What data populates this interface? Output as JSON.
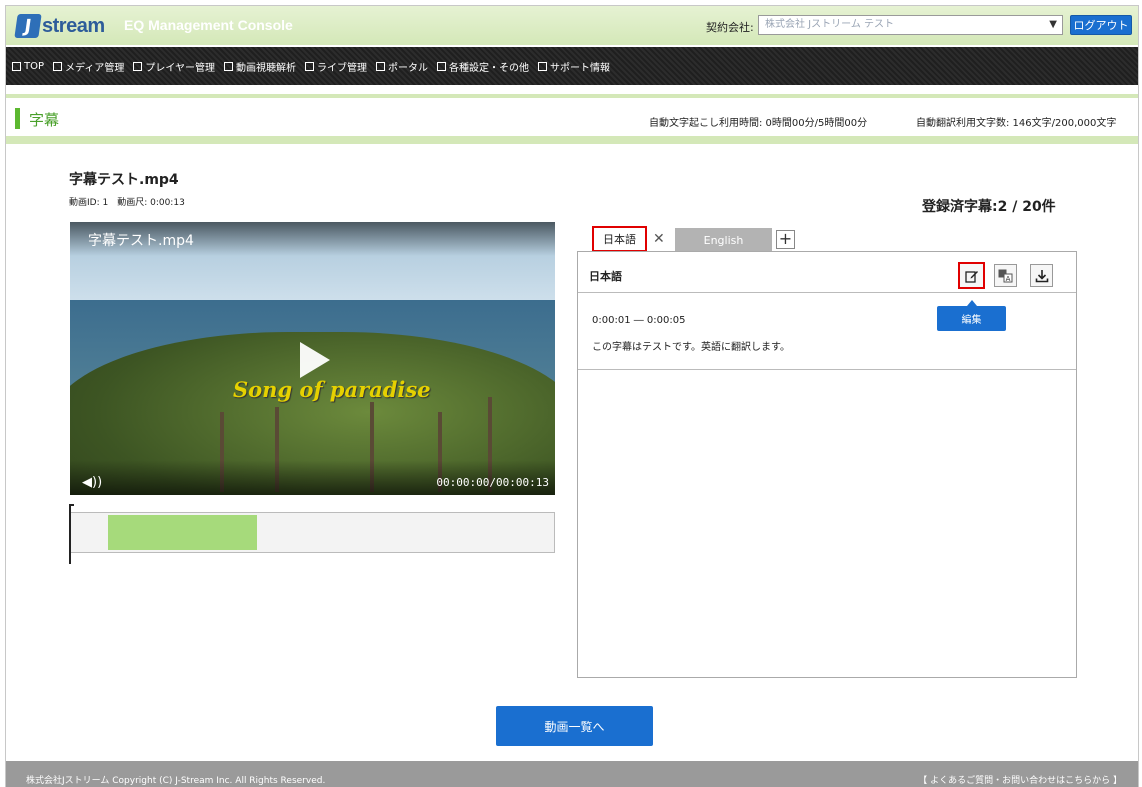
{
  "header": {
    "logo_text": "stream",
    "logo_letter": "J",
    "console_title": "EQ Management Console",
    "contract_label": "契約会社:",
    "contract_value": "株式会社 Jストリーム テスト",
    "logout_label": "ログアウト"
  },
  "nav": {
    "items": [
      "TOP",
      "メディア管理",
      "プレイヤー管理",
      "動画視聴解析",
      "ライブ管理",
      "ポータル",
      "各種設定・その他",
      "サポート情報"
    ]
  },
  "page": {
    "title": "字幕",
    "usage_transcription": "自動文字起こし利用時間: 0時間00分/5時間00分",
    "usage_translation": "自動翻訳利用文字数: 146文字/200,000文字"
  },
  "video": {
    "title": "字幕テスト.mp4",
    "meta": "動画ID: 1　動画尺: 0:00:13",
    "player_title": "字幕テスト.mp4",
    "overlay_text": "Song of paradise",
    "time": "00:00:00/00:00:13",
    "volume_icon": "◀))"
  },
  "subtitles": {
    "count_label": "登録済字幕:2 / 20件",
    "tabs": [
      "日本語",
      "English"
    ],
    "active_lang": "日本語",
    "tooltip": "編集",
    "cue": {
      "timecode": "0:00:01 ― 0:00:05",
      "text": "この字幕はテストです。英語に翻訳します。"
    }
  },
  "actions": {
    "back_label": "動画一覧へ"
  },
  "footer": {
    "copyright": "株式会社Jストリーム  Copyright (C) J-Stream Inc. All Rights Reserved.",
    "faq": "【 よくあるご質問・お問い合わせはこちらから 】"
  },
  "colors": {
    "accent_blue": "#1a6fd0",
    "accent_green": "#5cb830",
    "highlight_red": "#e00000"
  }
}
